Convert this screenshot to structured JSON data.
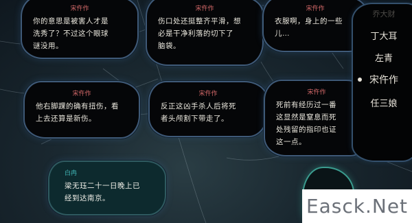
{
  "dialogue_cards": [
    {
      "speaker": "宋仵作",
      "lines": [
        "你的意思是被害人才是",
        "洗秀了？不过这个眼球",
        "谜没用。"
      ]
    },
    {
      "speaker": "宋仵作",
      "lines": [
        "伤口处还挺整齐平滑，想",
        "必是干净利落的切下了",
        "脑袋。"
      ]
    },
    {
      "speaker": "宋仵作",
      "lines": [
        "衣服啊，身上的一些",
        "儿…"
      ]
    },
    {
      "speaker": "宋仵作",
      "lines": [
        "他右脚踝的确有扭伤，看",
        "上去还算是新伤。"
      ]
    },
    {
      "speaker": "宋仵作",
      "lines": [
        "反正这凶手杀人后将死",
        "者头颅割下带走了。"
      ]
    },
    {
      "speaker": "宋仵作",
      "lines": [
        "死前有经历过一番",
        "这显然是窒息而死",
        "处残留的指印也证",
        "这一点。"
      ]
    },
    {
      "speaker": "白冉",
      "lines": [
        "梁无珏二十一日晚上已",
        "经到达南京。"
      ]
    }
  ],
  "character_panel": {
    "names": [
      "乔大财",
      "丁大耳",
      "左青",
      "宋仵作",
      "任三娘"
    ],
    "selected": "宋仵作"
  },
  "watermark": "Easck.Net"
}
